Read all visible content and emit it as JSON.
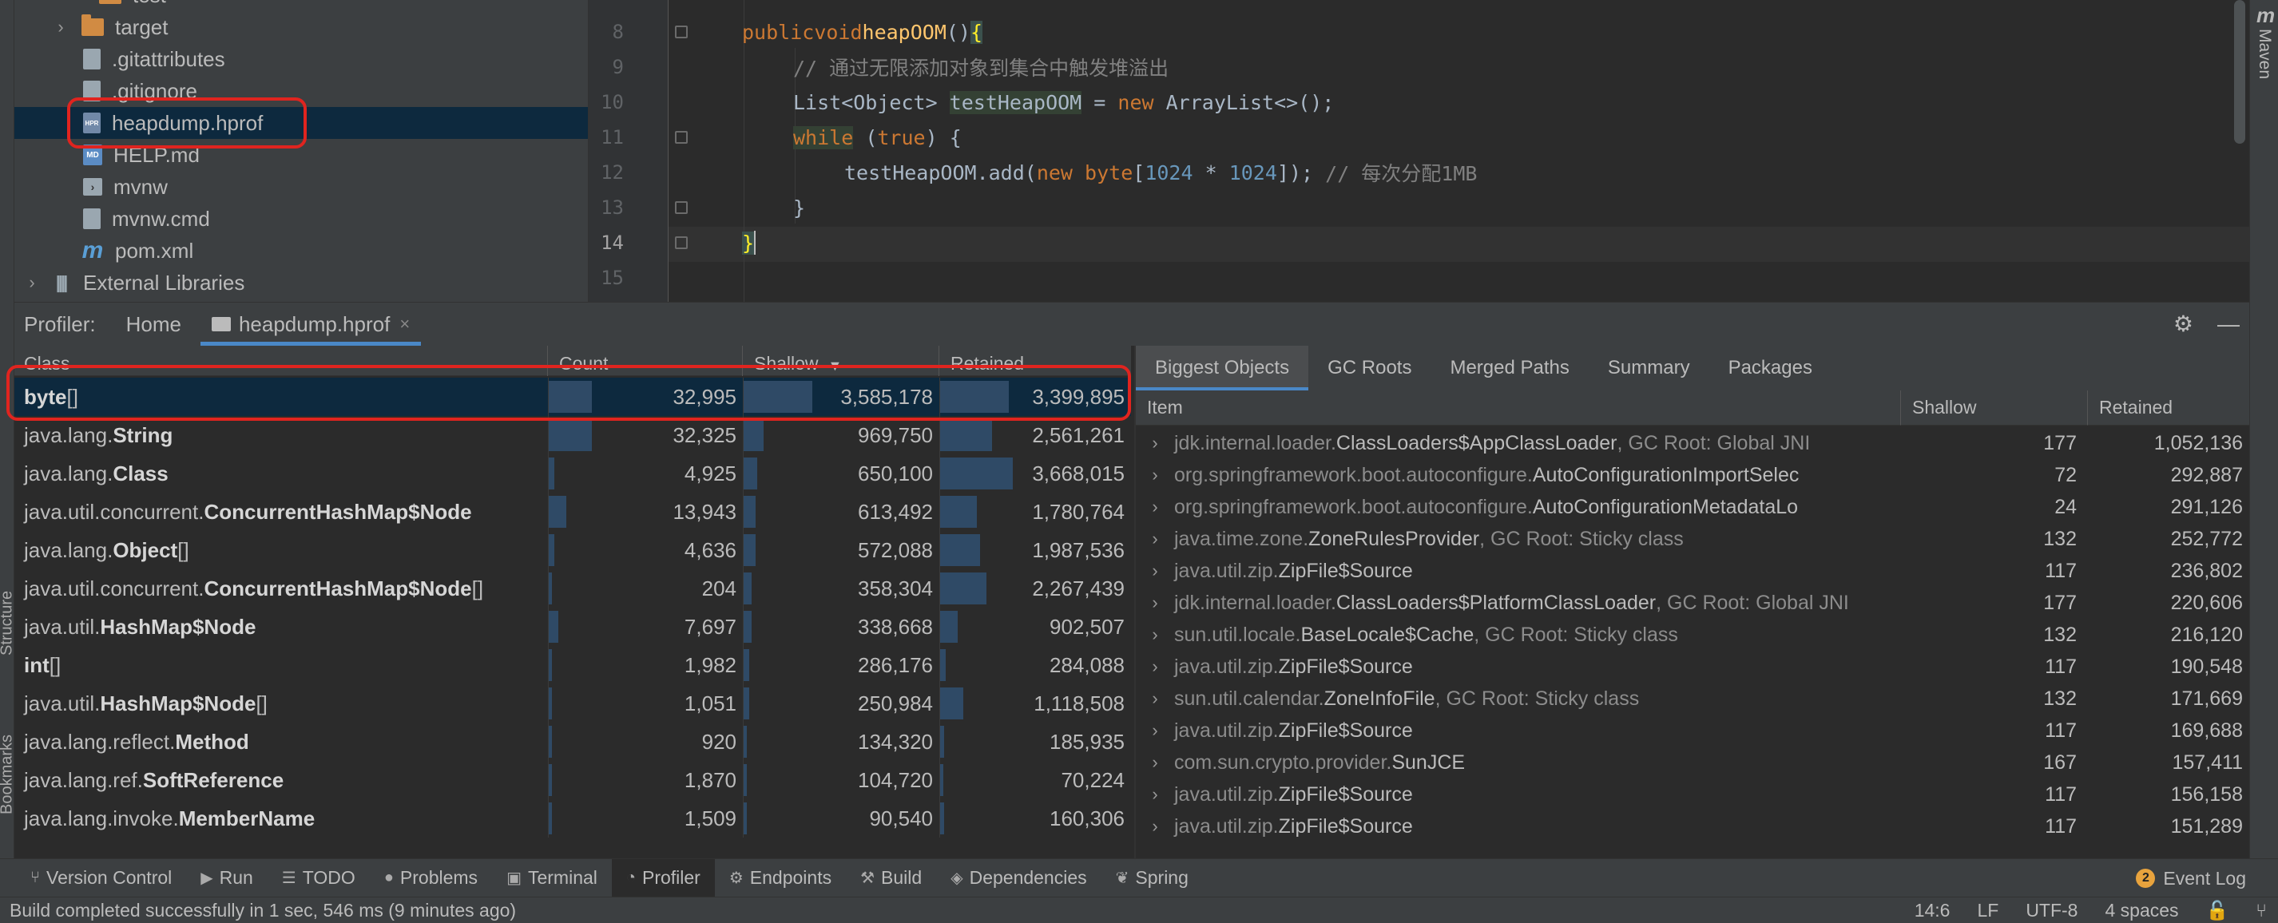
{
  "project_tree": {
    "items": [
      {
        "label": "test",
        "icon": "folder-icon"
      },
      {
        "label": "target",
        "icon": "folder-icon"
      },
      {
        "label": ".gitattributes",
        "icon": "file-icon"
      },
      {
        "label": ".gitignore",
        "icon": "file-icon"
      },
      {
        "label": "heapdump.hprof",
        "icon": "hprof-file-icon"
      },
      {
        "label": "HELP.md",
        "icon": "markdown-file-icon"
      },
      {
        "label": "mvnw",
        "icon": "terminal-file-icon"
      },
      {
        "label": "mvnw.cmd",
        "icon": "file-icon"
      },
      {
        "label": "pom.xml",
        "icon": "maven-icon"
      },
      {
        "label": "External Libraries",
        "icon": "libraries-icon"
      }
    ],
    "hprof_icon_text": "HPR",
    "md_icon_text": "MD",
    "maven_glyph": "m"
  },
  "editor": {
    "line_numbers": [
      "8",
      "9",
      "10",
      "11",
      "12",
      "13",
      "14",
      "15"
    ],
    "current_line": "14",
    "code": {
      "l8_public": "public",
      "l8_void": "void",
      "l8_name": "heapOOM",
      "l8_paren": "()",
      "l8_brace": "{",
      "l9_comment": "// 通过无限添加对象到集合中触发堆溢出",
      "l10_type": "List<Object> ",
      "l10_var": "testHeapOOM",
      "l10_eq": " = ",
      "l10_new": "new",
      "l10_rest": " ArrayList<>();",
      "l11_while": "while",
      "l11_open": " (",
      "l11_true": "true",
      "l11_rest": ") {",
      "l12_call": "testHeapOOM.add(",
      "l12_new": "new",
      "l12_sp": " ",
      "l12_byte": "byte",
      "l12_open": "[",
      "l12_n1": "1024",
      "l12_star": " * ",
      "l12_n2": "1024",
      "l12_close": "]); ",
      "l12_comment": "// 每次分配1MB",
      "l13": "}",
      "l14": "}"
    }
  },
  "right_strip": {
    "maven_tab": "Maven"
  },
  "left_strip": {
    "structure_tab": "Structure",
    "bookmarks_tab": "Bookmarks"
  },
  "profiler": {
    "label": "Profiler:",
    "tabs": [
      {
        "label": "Home"
      },
      {
        "label": "heapdump.hprof"
      }
    ],
    "close_glyph": "×",
    "class_table": {
      "columns": [
        "Class",
        "Count",
        "Shallow",
        "Retained"
      ],
      "sort_glyph": "▼",
      "rows": [
        {
          "prefix": "",
          "bold": "byte",
          "suffix": "[]",
          "count": "32,995",
          "shallow": "3,585,178",
          "retained": "3,399,895",
          "count_frac": 0.22,
          "shallow_frac": 0.35,
          "retained_frac": 0.36
        },
        {
          "prefix": "java.lang.",
          "bold": "String",
          "suffix": "",
          "count": "32,325",
          "shallow": "969,750",
          "retained": "2,561,261",
          "count_frac": 0.22,
          "shallow_frac": 0.1,
          "retained_frac": 0.27
        },
        {
          "prefix": "java.lang.",
          "bold": "Class",
          "suffix": "",
          "count": "4,925",
          "shallow": "650,100",
          "retained": "3,668,015",
          "count_frac": 0.03,
          "shallow_frac": 0.07,
          "retained_frac": 0.38
        },
        {
          "prefix": "java.util.concurrent.",
          "bold": "ConcurrentHashMap$Node",
          "suffix": "",
          "count": "13,943",
          "shallow": "613,492",
          "retained": "1,780,764",
          "count_frac": 0.09,
          "shallow_frac": 0.06,
          "retained_frac": 0.19
        },
        {
          "prefix": "java.lang.",
          "bold": "Object",
          "suffix": "[]",
          "count": "4,636",
          "shallow": "572,088",
          "retained": "1,987,536",
          "count_frac": 0.03,
          "shallow_frac": 0.06,
          "retained_frac": 0.21
        },
        {
          "prefix": "java.util.concurrent.",
          "bold": "ConcurrentHashMap$Node",
          "suffix": "[]",
          "count": "204",
          "shallow": "358,304",
          "retained": "2,267,439",
          "count_frac": 0.0,
          "shallow_frac": 0.04,
          "retained_frac": 0.24
        },
        {
          "prefix": "java.util.",
          "bold": "HashMap$Node",
          "suffix": "",
          "count": "7,697",
          "shallow": "338,668",
          "retained": "902,507",
          "count_frac": 0.05,
          "shallow_frac": 0.04,
          "retained_frac": 0.09
        },
        {
          "prefix": "",
          "bold": "int",
          "suffix": "[]",
          "count": "1,982",
          "shallow": "286,176",
          "retained": "284,088",
          "count_frac": 0.01,
          "shallow_frac": 0.03,
          "retained_frac": 0.03
        },
        {
          "prefix": "java.util.",
          "bold": "HashMap$Node",
          "suffix": "[]",
          "count": "1,051",
          "shallow": "250,984",
          "retained": "1,118,508",
          "count_frac": 0.01,
          "shallow_frac": 0.03,
          "retained_frac": 0.12
        },
        {
          "prefix": "java.lang.reflect.",
          "bold": "Method",
          "suffix": "",
          "count": "920",
          "shallow": "134,320",
          "retained": "185,935",
          "count_frac": 0.01,
          "shallow_frac": 0.01,
          "retained_frac": 0.02
        },
        {
          "prefix": "java.lang.ref.",
          "bold": "SoftReference",
          "suffix": "",
          "count": "1,870",
          "shallow": "104,720",
          "retained": "70,224",
          "count_frac": 0.01,
          "shallow_frac": 0.01,
          "retained_frac": 0.01
        },
        {
          "prefix": "java.lang.invoke.",
          "bold": "MemberName",
          "suffix": "",
          "count": "1,509",
          "shallow": "90,540",
          "retained": "160,306",
          "count_frac": 0.01,
          "shallow_frac": 0.01,
          "retained_frac": 0.02
        }
      ]
    },
    "detail": {
      "tabs": [
        "Biggest Objects",
        "GC Roots",
        "Merged Paths",
        "Summary",
        "Packages"
      ],
      "columns": [
        "Item",
        "Shallow",
        "Retained"
      ],
      "rows": [
        {
          "pkg": "jdk.internal.loader.",
          "cls": "ClassLoaders$AppClassLoader",
          "info": ", GC Root: Global JNI",
          "shallow": "177",
          "retained": "1,052,136"
        },
        {
          "pkg": "org.springframework.boot.autoconfigure.",
          "cls": "AutoConfigurationImportSelec",
          "info": "",
          "shallow": "72",
          "retained": "292,887"
        },
        {
          "pkg": "org.springframework.boot.autoconfigure.",
          "cls": "AutoConfigurationMetadataLo",
          "info": "",
          "shallow": "24",
          "retained": "291,126"
        },
        {
          "pkg": "java.time.zone.",
          "cls": "ZoneRulesProvider",
          "info": ", GC Root: Sticky class",
          "shallow": "132",
          "retained": "252,772"
        },
        {
          "pkg": "java.util.zip.",
          "cls": "ZipFile$Source",
          "info": "",
          "shallow": "117",
          "retained": "236,802"
        },
        {
          "pkg": "jdk.internal.loader.",
          "cls": "ClassLoaders$PlatformClassLoader",
          "info": ", GC Root: Global JNI",
          "shallow": "177",
          "retained": "220,606"
        },
        {
          "pkg": "sun.util.locale.",
          "cls": "BaseLocale$Cache",
          "info": ", GC Root: Sticky class",
          "shallow": "132",
          "retained": "216,120"
        },
        {
          "pkg": "java.util.zip.",
          "cls": "ZipFile$Source",
          "info": "",
          "shallow": "117",
          "retained": "190,548"
        },
        {
          "pkg": "sun.util.calendar.",
          "cls": "ZoneInfoFile",
          "info": ", GC Root: Sticky class",
          "shallow": "132",
          "retained": "171,669"
        },
        {
          "pkg": "java.util.zip.",
          "cls": "ZipFile$Source",
          "info": "",
          "shallow": "117",
          "retained": "169,688"
        },
        {
          "pkg": "com.sun.crypto.provider.",
          "cls": "SunJCE",
          "info": "",
          "shallow": "167",
          "retained": "157,411"
        },
        {
          "pkg": "java.util.zip.",
          "cls": "ZipFile$Source",
          "info": "",
          "shallow": "117",
          "retained": "156,158"
        },
        {
          "pkg": "java.util.zip.",
          "cls": "ZipFile$Source",
          "info": "",
          "shallow": "117",
          "retained": "151,289"
        }
      ]
    }
  },
  "toolbar": {
    "items": [
      {
        "label": "Version Control",
        "icon": "version-control-icon",
        "glyph": "⑂"
      },
      {
        "label": "Run",
        "icon": "run-icon",
        "glyph": "▶"
      },
      {
        "label": "TODO",
        "icon": "todo-icon",
        "glyph": "☰"
      },
      {
        "label": "Problems",
        "icon": "problems-icon",
        "glyph": "●"
      },
      {
        "label": "Terminal",
        "icon": "terminal-icon",
        "glyph": "▣"
      },
      {
        "label": "Profiler",
        "icon": "profiler-icon",
        "glyph": "◔"
      },
      {
        "label": "Endpoints",
        "icon": "endpoints-icon",
        "glyph": "⚙"
      },
      {
        "label": "Build",
        "icon": "build-icon",
        "glyph": "⚒"
      },
      {
        "label": "Dependencies",
        "icon": "dependencies-icon",
        "glyph": "◈"
      },
      {
        "label": "Spring",
        "icon": "spring-icon",
        "glyph": "❦"
      }
    ],
    "active": "Profiler",
    "event_log": {
      "label": "Event Log",
      "badge": "2"
    }
  },
  "statusbar": {
    "message": "Build completed successfully in 1 sec, 546 ms (9 minutes ago)",
    "position": "14:6",
    "line_sep": "LF",
    "encoding": "UTF-8",
    "indent": "4 spaces"
  },
  "colors": {
    "accent": "#4a88c7",
    "selection": "#0d293e",
    "highlight_box": "#e0241f"
  }
}
